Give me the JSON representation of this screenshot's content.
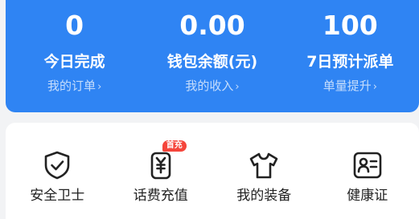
{
  "stats": [
    {
      "value": "0",
      "label": "今日完成",
      "link": "我的订单"
    },
    {
      "value": "0.00",
      "label": "钱包余额(元)",
      "link": "我的收入"
    },
    {
      "value": "100",
      "label": "7日预计派单",
      "link": "单量提升"
    }
  ],
  "chevron": "›",
  "services": [
    {
      "label": "安全卫士",
      "icon": "shield-check-icon"
    },
    {
      "label": "话费充值",
      "icon": "phone-yuan-icon",
      "badge": "首充"
    },
    {
      "label": "我的装备",
      "icon": "tshirt-icon"
    },
    {
      "label": "健康证",
      "icon": "id-card-icon"
    }
  ],
  "colors": {
    "accent": "#2f84f3",
    "badge": "#f5453b",
    "background": "#f2f3f5"
  }
}
